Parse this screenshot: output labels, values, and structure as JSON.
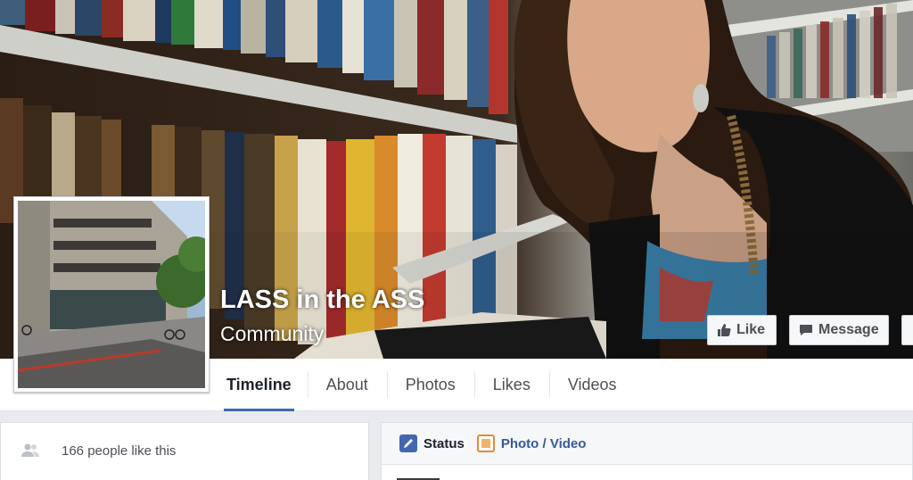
{
  "page": {
    "name": "LASS in the ASS",
    "category": "Community"
  },
  "actions": {
    "like_label": "Like",
    "message_label": "Message",
    "more_label": "•••"
  },
  "tabs": [
    {
      "label": "Timeline",
      "active": true
    },
    {
      "label": "About",
      "active": false
    },
    {
      "label": "Photos",
      "active": false
    },
    {
      "label": "Likes",
      "active": false
    },
    {
      "label": "Videos",
      "active": false
    }
  ],
  "sidebar": {
    "likes_text": "166 people like this"
  },
  "composer": {
    "status_label": "Status",
    "photo_label": "Photo / Video"
  },
  "colors": {
    "accent": "#4267b2",
    "link": "#365899",
    "background": "#e9ebee"
  },
  "icons": [
    "thumbs-up-icon",
    "message-icon",
    "people-icon",
    "pencil-icon",
    "photo-icon"
  ]
}
